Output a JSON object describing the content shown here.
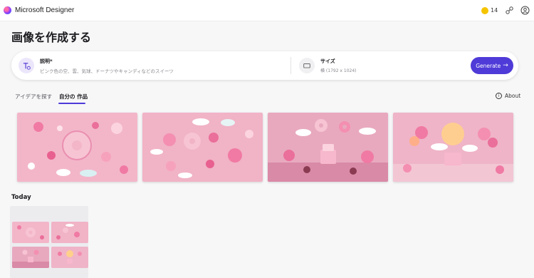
{
  "app": {
    "title": "Microsoft Designer"
  },
  "header": {
    "coins": "14",
    "icons": [
      "coin-icon",
      "share-icon",
      "account-icon"
    ]
  },
  "page": {
    "title": "画像を作成する"
  },
  "prompt": {
    "description_label": "説明*",
    "description_placeholder": "ピンク色の空、雲、気球、ドーナツやキャンディなどのスイーツ",
    "size_label": "サイズ",
    "size_value": "横 (1792 x 1024)",
    "generate_label": "Generate"
  },
  "tabs": [
    {
      "label": "アイデアを探す",
      "active": false
    },
    {
      "label": "自分の 作品",
      "active": true
    }
  ],
  "about_label": "About",
  "generated_images": [
    {
      "alt_theme": "donut-flatlay"
    },
    {
      "alt_theme": "sweets-flatlay"
    },
    {
      "alt_theme": "cake-scene"
    },
    {
      "alt_theme": "balloon-scene"
    }
  ],
  "history": {
    "title": "Today",
    "thumbnail_count": 4
  },
  "colors": {
    "accent": "#4f3bd8",
    "pink_bg": "#f2b4c8",
    "coin": "#f5c400"
  }
}
